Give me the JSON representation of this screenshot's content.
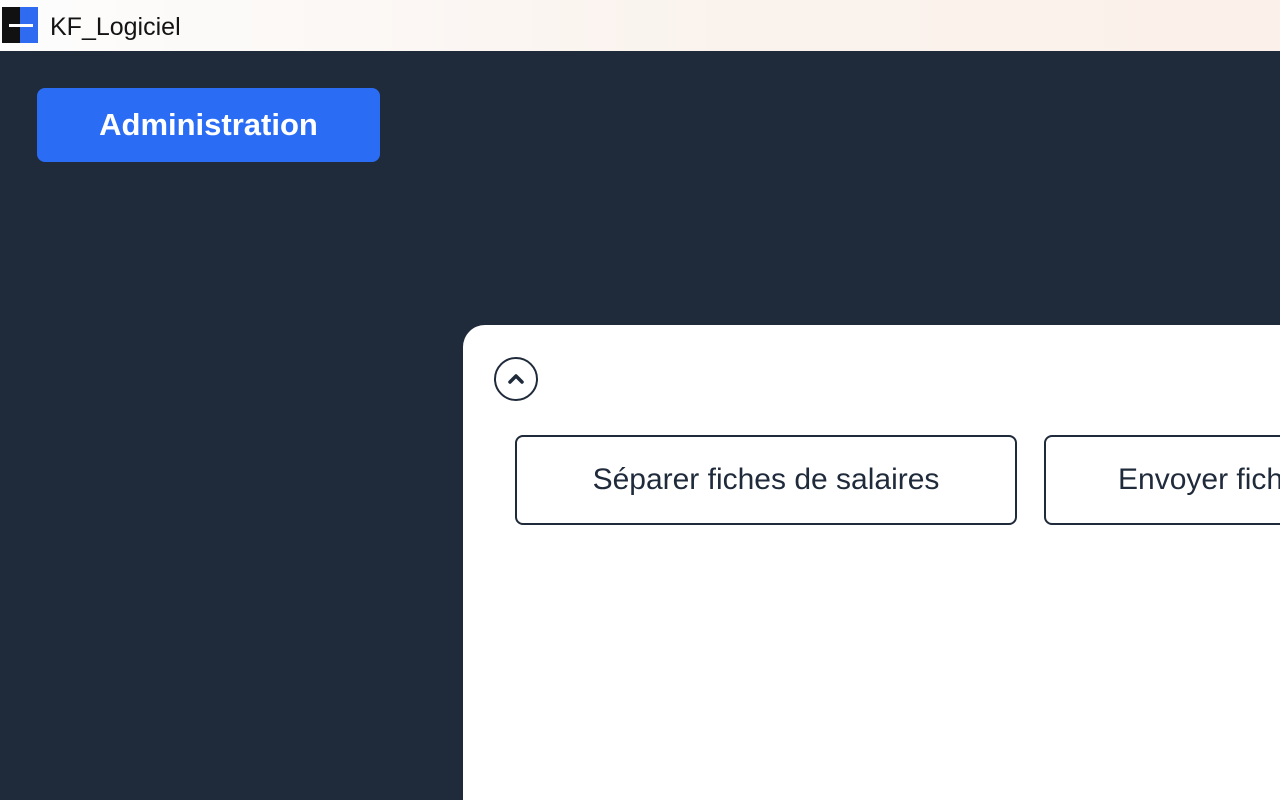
{
  "window": {
    "title": "KF_Logiciel",
    "icon": "kf-app-icon"
  },
  "nav": {
    "admin_label": "Administration"
  },
  "panel": {
    "collapse_icon": "chevron-up-icon",
    "actions": [
      {
        "label": "Séparer fiches de salaires"
      },
      {
        "label": "Envoyer fich"
      }
    ]
  },
  "colors": {
    "background": "#1f2a3b",
    "accent": "#2a6df4",
    "panel": "#ffffff"
  }
}
